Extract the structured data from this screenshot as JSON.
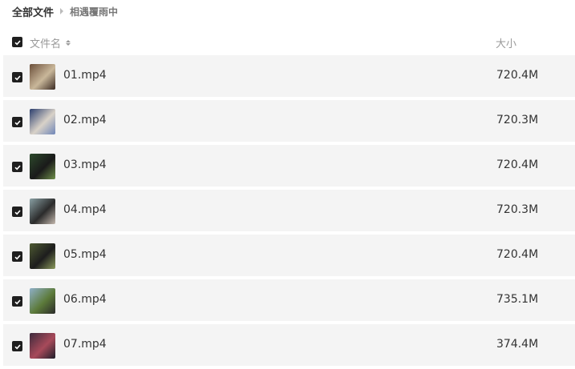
{
  "breadcrumb": {
    "root": "全部文件",
    "current": "相遇覆雨中"
  },
  "header": {
    "name_label": "文件名",
    "size_label": "大小"
  },
  "files": [
    {
      "name": "01.mp4",
      "size": "720.4M",
      "thumb": [
        "#6b4f3a",
        "#c9b79a",
        "#3a2a22"
      ]
    },
    {
      "name": "02.mp4",
      "size": "720.3M",
      "thumb": [
        "#2c3f6e",
        "#d9d2c8",
        "#6f86b8"
      ]
    },
    {
      "name": "03.mp4",
      "size": "720.4M",
      "thumb": [
        "#2d4a2c",
        "#1a1a1a",
        "#6e8f4a"
      ]
    },
    {
      "name": "04.mp4",
      "size": "720.3M",
      "thumb": [
        "#8aa0a4",
        "#2b2b2b",
        "#c4b8ae"
      ]
    },
    {
      "name": "05.mp4",
      "size": "720.4M",
      "thumb": [
        "#4e5a32",
        "#1d1d1d",
        "#8b9a5c"
      ]
    },
    {
      "name": "06.mp4",
      "size": "735.1M",
      "thumb": [
        "#8fb0c8",
        "#5c7a3a",
        "#2a2a2a"
      ]
    },
    {
      "name": "07.mp4",
      "size": "374.4M",
      "thumb": [
        "#3c2a3c",
        "#a84a5a",
        "#1e1e2a"
      ]
    }
  ]
}
